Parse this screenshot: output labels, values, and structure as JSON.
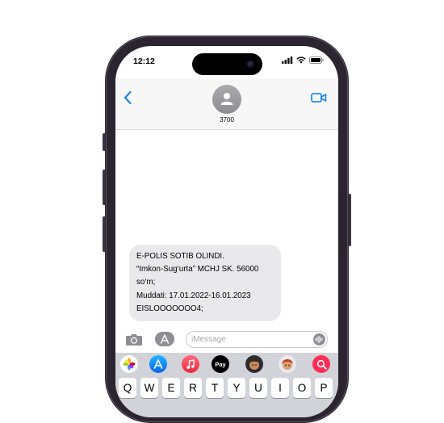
{
  "status_bar": {
    "time": "12:12"
  },
  "conversation": {
    "contact_name": "3700"
  },
  "message": {
    "lines": [
      "E-POLIS SOTIB OLINDI.",
      "“Imkon-Sug‘urta” MCHJ SK. 56000",
      "so‘m;",
      "Muddati: 17.01.2022-16.01.2023",
      "EISLOOOOOOO4;"
    ]
  },
  "composer": {
    "placeholder": "iMessage"
  },
  "app_drawer": {
    "apps": [
      "photos-icon",
      "app-store-icon",
      "music-icon",
      "apple-pay-icon",
      "memoji-icon",
      "memoji-2-icon",
      "search-images-icon"
    ],
    "apple_pay_label": "Pay"
  },
  "keyboard": {
    "row1": [
      "Q",
      "W",
      "E",
      "R",
      "T",
      "Y",
      "U",
      "I",
      "O",
      "P"
    ]
  },
  "colors": {
    "accent": "#007aff",
    "bubble": "#e9e9eb",
    "keyboard_bg": "#d1d3d9"
  }
}
